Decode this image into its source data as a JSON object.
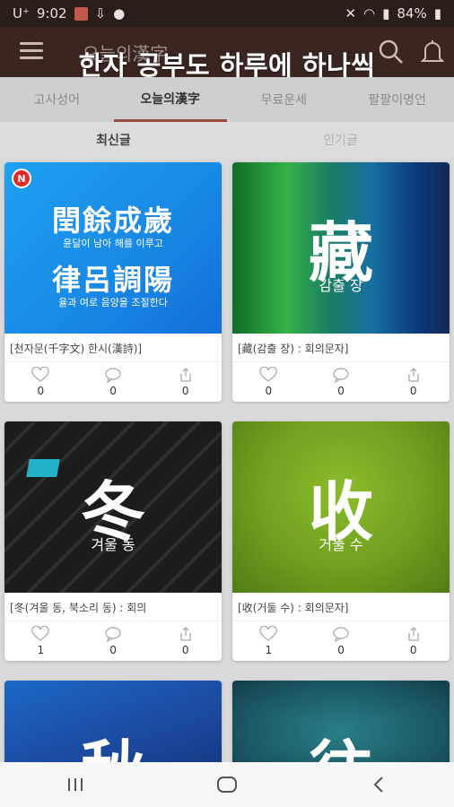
{
  "status_bar": {
    "carrier": "U⁺",
    "time": "9:02",
    "battery": "84%",
    "icons": [
      "notification-icon",
      "download-icon",
      "person-icon",
      "mute-icon",
      "wifi-icon",
      "signal-icon",
      "battery-icon"
    ]
  },
  "header": {
    "title": "오늘의漢字",
    "icons": [
      "menu-icon",
      "search-icon",
      "bell-icon"
    ]
  },
  "promo_text": "한자 공부도 하루에 하나씩",
  "tabs": [
    {
      "label": "고사성어",
      "active": false
    },
    {
      "label": "오늘의漢字",
      "active": true
    },
    {
      "label": "무료운세",
      "active": false
    },
    {
      "label": "팔팔이명언",
      "active": false
    }
  ],
  "subtabs": [
    {
      "label": "최신글",
      "active": true
    },
    {
      "label": "인기글",
      "active": false
    }
  ],
  "cards": [
    {
      "badge": "N",
      "poem": {
        "line1": "閏餘成歲",
        "sub1": "윤달이 남아 해를 이루고",
        "line2": "律呂調陽",
        "sub2": "율과 여로 음양을 조절한다"
      },
      "caption": "[천자문(千字文) 한시(漢詩)]",
      "likes": "0",
      "comments": "0",
      "shares": "0"
    },
    {
      "hanja": "藏",
      "reading": "감출 장",
      "caption": "[藏(감출 장) : 회의문자]",
      "likes": "0",
      "comments": "0",
      "shares": "0"
    },
    {
      "hanja": "冬",
      "reading": "겨울 동",
      "caption": "[冬(겨울 동, 북소리 동) : 회의",
      "likes": "1",
      "comments": "0",
      "shares": "0"
    },
    {
      "hanja": "收",
      "reading": "거둘 수",
      "caption": "[收(거둘 수) : 회의문자]",
      "likes": "1",
      "comments": "0",
      "shares": "0"
    },
    {
      "hanja": "秋"
    },
    {
      "hanja": "往"
    }
  ],
  "colors": {
    "accent": "#9a4a3e",
    "new_badge": "#e12b2b"
  },
  "nav_icons": [
    "recent-apps-icon",
    "home-icon",
    "back-icon"
  ]
}
